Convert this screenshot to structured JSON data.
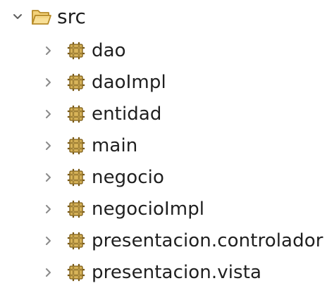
{
  "tree": {
    "root": {
      "label": "src",
      "expanded": true,
      "icon": "folder-icon"
    },
    "children": [
      {
        "label": "dao",
        "icon": "package-icon",
        "expanded": false
      },
      {
        "label": "daoImpl",
        "icon": "package-icon",
        "expanded": false
      },
      {
        "label": "entidad",
        "icon": "package-icon",
        "expanded": false
      },
      {
        "label": "main",
        "icon": "package-icon",
        "expanded": false
      },
      {
        "label": "negocio",
        "icon": "package-icon",
        "expanded": false
      },
      {
        "label": "negocioImpl",
        "icon": "package-icon",
        "expanded": false
      },
      {
        "label": "presentacion.controlador",
        "icon": "package-icon",
        "expanded": false
      },
      {
        "label": "presentacion.vista",
        "icon": "package-icon",
        "expanded": false
      }
    ]
  },
  "colors": {
    "text": "#1f1f1f",
    "chevron": "#8a8a8a",
    "folder_fill": "#f6d98a",
    "folder_stroke": "#b78b28",
    "package_fill": "#c8a24a",
    "package_stroke": "#7a5a14"
  }
}
